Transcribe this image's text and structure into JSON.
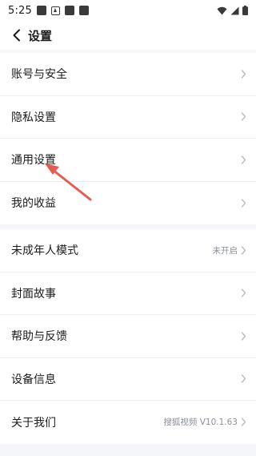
{
  "status_bar": {
    "time": "5:25",
    "notification_icons": [
      "square-icon",
      "app-icon",
      "square-icon",
      "square-icon"
    ],
    "right_icons": [
      "wifi-icon",
      "signal-icon",
      "battery-icon"
    ]
  },
  "header": {
    "back_icon": "chevron-left-icon",
    "title": "设置"
  },
  "group1": [
    {
      "label": "账号与安全",
      "value": ""
    },
    {
      "label": "隐私设置",
      "value": ""
    },
    {
      "label": "通用设置",
      "value": ""
    },
    {
      "label": "我的收益",
      "value": ""
    }
  ],
  "group2": [
    {
      "label": "未成年人模式",
      "value": "未开启"
    },
    {
      "label": "封面故事",
      "value": ""
    },
    {
      "label": "帮助与反馈",
      "value": ""
    },
    {
      "label": "设备信息",
      "value": ""
    },
    {
      "label": "关于我们",
      "value": "搜狐视频 V10.1.63"
    }
  ],
  "annotation": {
    "type": "red-arrow-icon",
    "points_to": "通用设置",
    "color": "#e85a52"
  },
  "colors": {
    "background": "#f4f6f9",
    "row_background": "#ffffff",
    "text": "#1c1c1c",
    "secondary_text": "#8a8f99",
    "chevron": "#b8bcc4"
  }
}
